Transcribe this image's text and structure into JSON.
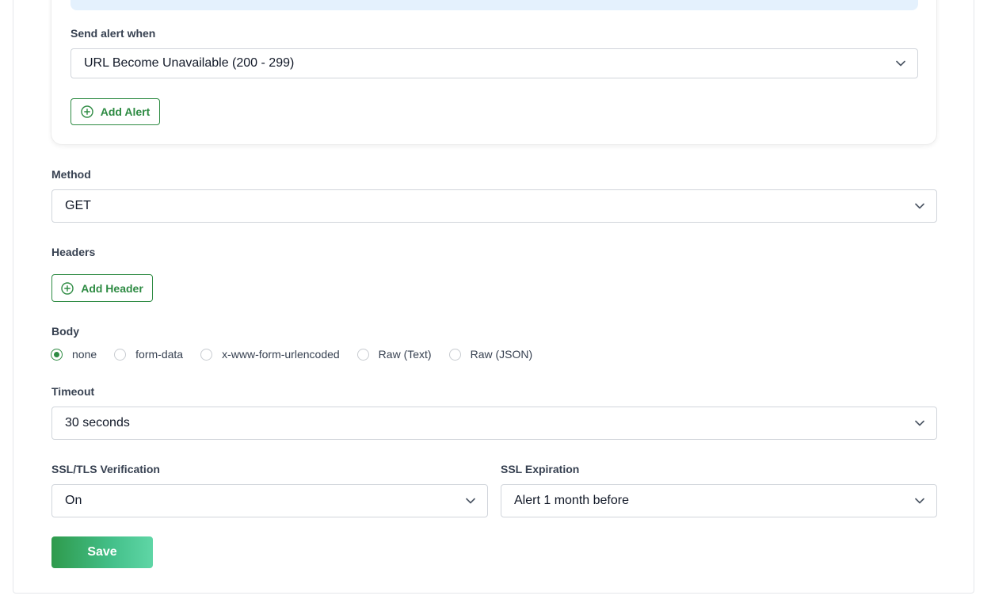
{
  "alerts": {
    "send_alert_label": "Send alert when",
    "send_alert_value": "URL Become Unavailable (200 - 299)",
    "add_alert_label": "Add Alert"
  },
  "method": {
    "label": "Method",
    "value": "GET"
  },
  "headers": {
    "label": "Headers",
    "add_header_label": "Add Header"
  },
  "body": {
    "label": "Body",
    "options": [
      "none",
      "form-data",
      "x-www-form-urlencoded",
      "Raw (Text)",
      "Raw (JSON)"
    ],
    "selected": "none"
  },
  "timeout": {
    "label": "Timeout",
    "value": "30 seconds"
  },
  "ssl_verification": {
    "label": "SSL/TLS Verification",
    "value": "On"
  },
  "ssl_expiration": {
    "label": "SSL Expiration",
    "value": "Alert 1 month before"
  },
  "actions": {
    "save_label": "Save"
  },
  "colors": {
    "accent": "#2e8b43",
    "info_background": "#e4f1fd"
  },
  "icons": [
    "plus-circle-icon",
    "chevron-down-icon"
  ]
}
